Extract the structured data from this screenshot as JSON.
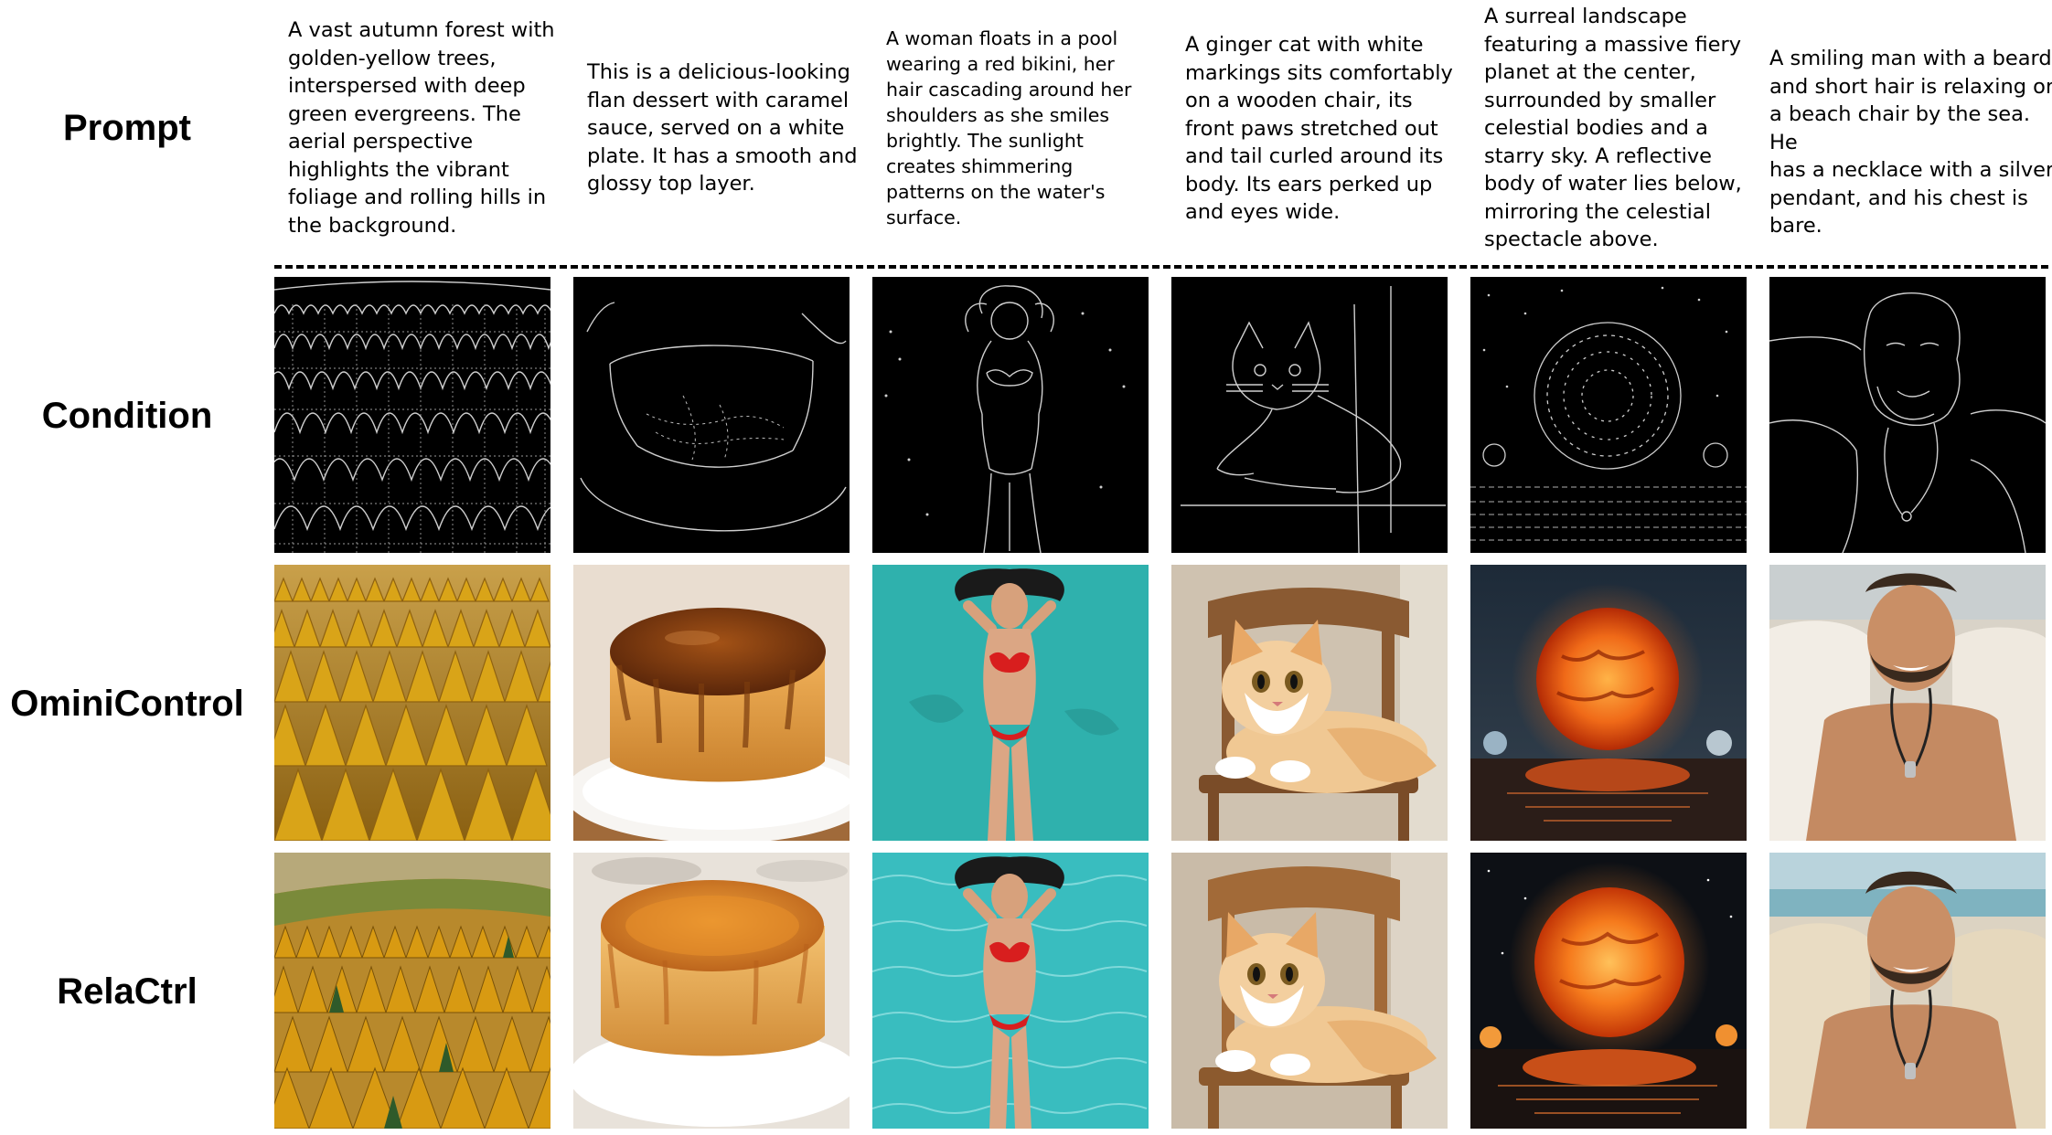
{
  "row_labels": {
    "prompt": "Prompt",
    "condition": "Condition",
    "ominicontrol": "OminiControl",
    "relactrl": "RelaCtrl"
  },
  "prompts": [
    "A vast autumn forest with\ngolden-yellow trees,\ninterspersed with deep\ngreen evergreens. The\naerial perspective\nhighlights the vibrant\nfoliage and rolling hills in\nthe background.",
    "This is a delicious-looking\nflan dessert with caramel\nsauce, served on a white\nplate. It has a smooth and\nglossy top layer.",
    "A woman floats in a pool\nwearing a red bikini, her\nhair cascading around her\nshoulders as she smiles\nbrightly. The sunlight\ncreates shimmering\npatterns on the water's\nsurface.",
    "A ginger cat with white\nmarkings sits comfortably\non a wooden chair, its\nfront paws stretched out\nand tail curled around its\nbody. Its ears perked up\nand eyes wide.",
    "A surreal landscape\nfeaturing a massive fiery\nplanet at the center,\nsurrounded by smaller\ncelestial bodies and a\nstarry sky. A reflective\nbody of water lies below,\nmirroring the celestial\nspectacle above.",
    "A smiling man with a beard\nand short hair is relaxing on\na beach chair by the sea. He\nhas a necklace with a silver\npendant, and his chest is\nbare."
  ],
  "colors": {
    "edge_background": "#000000",
    "edge_lines": "#d0d0d0",
    "forest_gold": "#d49a12",
    "pool_teal": "#2fb3b0",
    "bikini_red": "#d81e1e",
    "planet_orange": "#f06a18"
  }
}
